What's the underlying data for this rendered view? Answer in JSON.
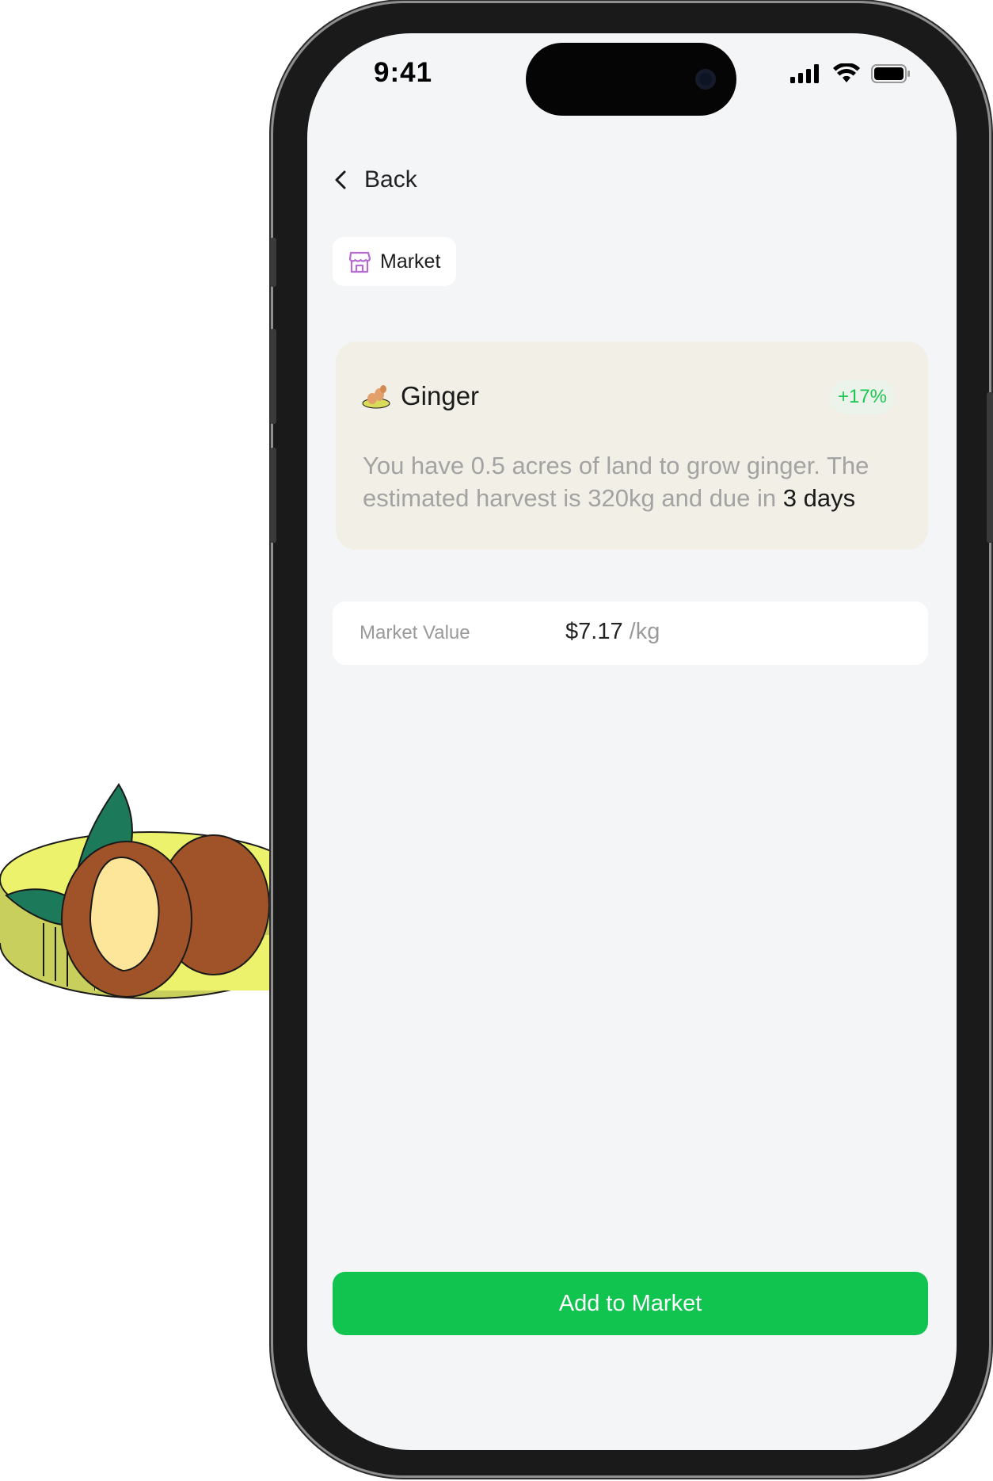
{
  "status_bar": {
    "time": "9:41"
  },
  "nav": {
    "back_label": "Back"
  },
  "chip": {
    "label": "Market",
    "icon": "storefront-icon",
    "icon_color": "#b56bd1"
  },
  "crop": {
    "name": "Ginger",
    "icon": "ginger-icon",
    "change": "+17%",
    "description_prefix": "You have 0.5 acres of land to grow ginger. The estimated harvest is 320kg and due in ",
    "description_highlight": "3 days"
  },
  "market_value": {
    "label": "Market Value",
    "price": "$7.17",
    "unit": " /kg"
  },
  "action": {
    "label": "Add to Market",
    "color": "#11c34f"
  },
  "colors": {
    "accent": "#11c34f",
    "badge_text": "#1fc552",
    "card_bg": "#f1efe6",
    "screen_bg": "#f4f5f7"
  }
}
